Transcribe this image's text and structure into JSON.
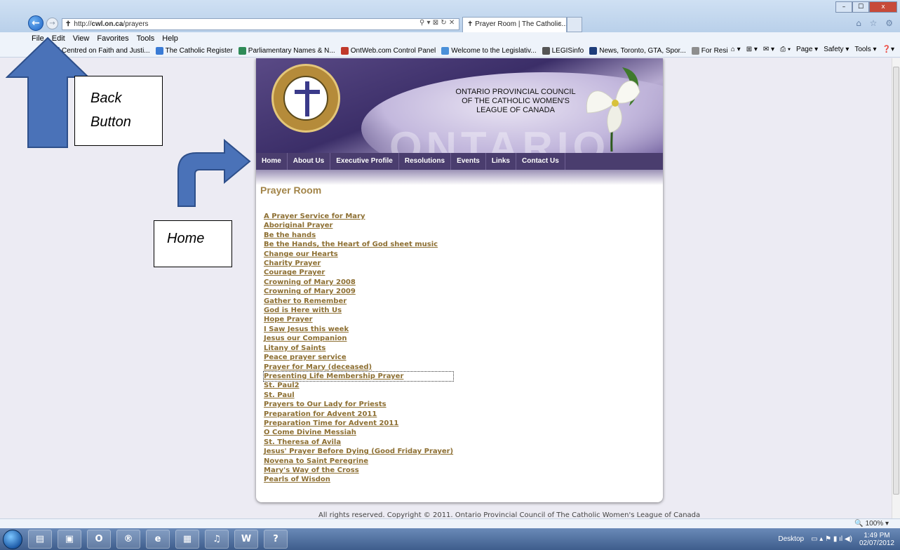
{
  "browser": {
    "url_prefix": "http://",
    "url_domain": "cwl.on.ca",
    "url_path": "/prayers",
    "address_controls": "⚲ ▾ ⊠ ↻ ✕",
    "tab_title": "Prayer Room | The Catholic...",
    "tab_close": "×",
    "menu": [
      "File",
      "Edit",
      "View",
      "Favorites",
      "Tools",
      "Help"
    ],
    "favorites": [
      {
        "label": "Centred on Faith and Justi...",
        "color": "#1d63c5"
      },
      {
        "label": "The Catholic Register",
        "color": "#3a7bd5"
      },
      {
        "label": "Parliamentary Names & N...",
        "color": "#2e8b57"
      },
      {
        "label": "OntWeb.com Control Panel",
        "color": "#c0392b"
      },
      {
        "label": "Welcome to the Legislativ...",
        "color": "#4a90d9"
      },
      {
        "label": "LEGISinfo",
        "color": "#555555"
      },
      {
        "label": "News, Toronto, GTA, Spor...",
        "color": "#1e3d7a"
      },
      {
        "label": "For Residents - Ontario",
        "color": "#8e8e8e"
      }
    ],
    "command_bar": [
      "Page ▾",
      "Safety ▾",
      "Tools ▾"
    ],
    "window_controls": [
      "–",
      "☐",
      "x"
    ],
    "chrome_icons": "⌂ ☆ ⚙",
    "zoom": "100%"
  },
  "site": {
    "council_title_lines": [
      "ONTARIO PROVINCIAL COUNCIL",
      "OF THE CATHOLIC WOMEN'S",
      "LEAGUE OF CANADA"
    ],
    "banner_word": "ONTARIO",
    "nav": [
      "Home",
      "About Us",
      "Executive Profile",
      "Resolutions",
      "Events",
      "Links",
      "Contact Us"
    ],
    "page_title": "Prayer Room",
    "prayers": [
      "A Prayer Service for Mary",
      "Aboriginal Prayer",
      "Be the hands",
      "Be the Hands, the Heart of God sheet music",
      "Change our Hearts",
      "Charity Prayer",
      "Courage Prayer",
      "Crowning of Mary 2008",
      "Crowning of Mary 2009",
      "Gather to Remember",
      "God is Here with Us",
      "Hope Prayer",
      "I Saw Jesus this week",
      "Jesus our Companion",
      "Litany of Saints",
      "Peace prayer service",
      "Prayer for Mary (deceased)",
      "Presenting Life Membership Prayer",
      "St. Paul2",
      "St. Paul",
      "Prayers to Our Lady for Priests",
      "Preparation for Advent 2011",
      "Preparation Time for Advent 2011",
      "O Come Divine Messiah",
      "St. Theresa of Avila",
      "Jesus' Prayer Before Dying (Good Friday Prayer)",
      "Novena to Saint Peregrine",
      "Mary's Way of the Cross",
      "Pearls of Wisdon"
    ],
    "focused_prayer": "Presenting Life Membership Prayer",
    "footer": "All rights reserved. Copyright © 2011. Ontario Provincial Council of The Catholic Women's League of Canada",
    "colors": {
      "link": "#8d6f32",
      "title": "#a28448",
      "nav_bg": "#4a3d6e"
    }
  },
  "annotations": {
    "back_line1": "Back",
    "back_line2": "Button",
    "home": "Home",
    "arrow_color": "#4a72b8"
  },
  "taskbar": {
    "tray_desktop": "Desktop",
    "time": "1:49 PM",
    "date": "02/07/2012",
    "apps": [
      "explorer-icon",
      "media-center-icon",
      "outlook-icon",
      "remote-icon",
      "ie-icon",
      "calculator-icon",
      "itunes-icon",
      "word-icon",
      "help-icon"
    ]
  }
}
